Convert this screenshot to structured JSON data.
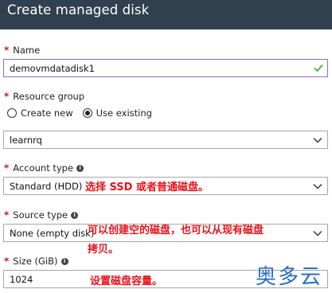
{
  "header": {
    "title": "Create managed disk"
  },
  "form": {
    "name": {
      "label": "Name",
      "value": "demovmdatadisk1"
    },
    "resource_group": {
      "label": "Resource group",
      "options": [
        "Create new",
        "Use existing"
      ],
      "selected": "Use existing",
      "value": "learnrq"
    },
    "account_type": {
      "label": "Account type",
      "value": "Standard (HDD)"
    },
    "source_type": {
      "label": "Source type",
      "value": "None (empty disk)"
    },
    "size": {
      "label": "Size (GiB)",
      "value": "1024"
    }
  },
  "annotations": {
    "account_type_note": "选择 SSD 或者普通磁盘。",
    "source_type_note_line1": "可以创建空的磁盘，也可以从现有磁盘",
    "source_type_note_line2": "拷贝。",
    "size_note": "设置磁盘容量。"
  },
  "watermark": "奥多云",
  "icons": {
    "required": "asterisk-icon",
    "info": "info-icon",
    "valid": "check-icon",
    "dropdown": "chevron-down-icon"
  },
  "colors": {
    "header_bg": "#30404f",
    "required": "#c81e1e",
    "annotation": "#e8141c",
    "valid_check": "#5bb33c",
    "focus_border": "#8b6dc6",
    "watermark": "#2a6fbe"
  }
}
